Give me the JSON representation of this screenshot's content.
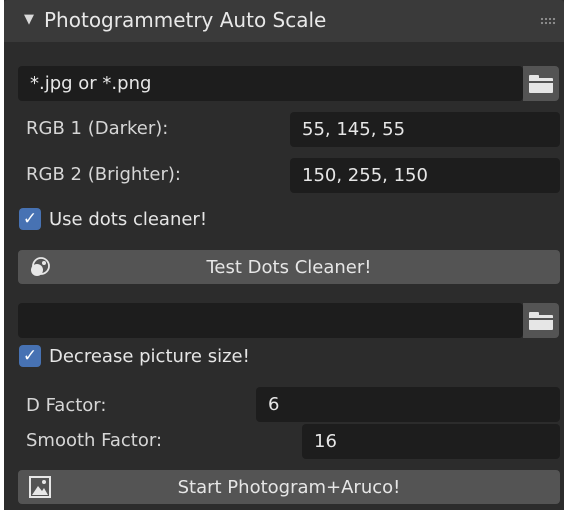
{
  "panel": {
    "title": "Photogrammetry Auto Scale",
    "collapse_icon": "triangle-down-icon",
    "drag_icon": "grip-dots-icon"
  },
  "image_path": {
    "value": "*.jpg or *.png",
    "browse_icon": "folder-icon"
  },
  "rgb1": {
    "label": "RGB 1 (Darker):",
    "value": "55, 145, 55"
  },
  "rgb2": {
    "label": "RGB 2 (Brighter):",
    "value": "150, 255, 150"
  },
  "dots_cleaner": {
    "label": "Use dots cleaner!",
    "checked": true
  },
  "test_button": {
    "label": "Test Dots Cleaner!",
    "icon": "mask-icon"
  },
  "second_path": {
    "value": "",
    "browse_icon": "folder-icon"
  },
  "decrease_size": {
    "label": "Decrease picture size!",
    "checked": true
  },
  "d_factor": {
    "label": "D Factor:",
    "value": "6"
  },
  "smooth_factor": {
    "label": "Smooth Factor:",
    "value": "16"
  },
  "start_button": {
    "label": "Start Photogram+Aruco!",
    "icon": "image-icon"
  },
  "colors": {
    "accent": "#4772b3",
    "panel": "#2c2c2c",
    "field": "#1d1d1d",
    "button": "#545454"
  }
}
